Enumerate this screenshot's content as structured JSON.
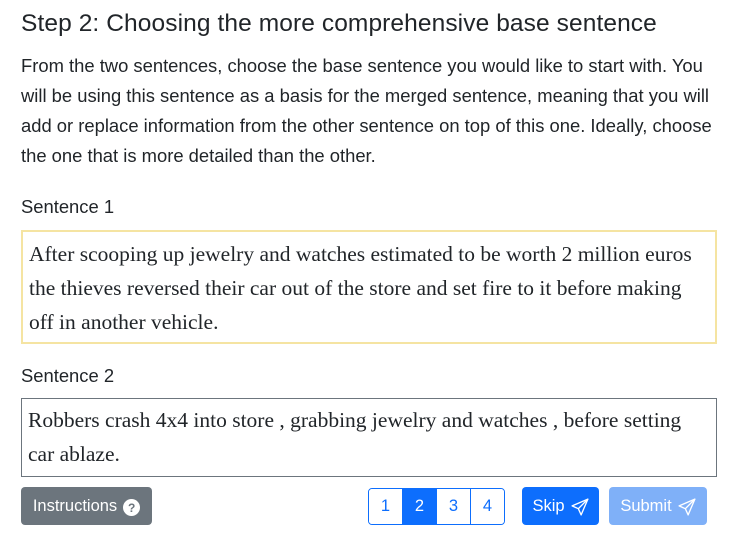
{
  "header": {
    "title": "Step 2: Choosing the more comprehensive base sentence",
    "description": "From the two sentences, choose the base sentence you would like to start with. You will be using this sentence as a basis for the merged sentence, meaning that you will add or replace information from the other sentence on top of this one. Ideally, choose the one that is more detailed than the other."
  },
  "sentences": [
    {
      "label": "Sentence 1",
      "text": "After scooping up jewelry and watches estimated to be worth 2 million euros the thieves reversed their car out of the store and set fire to it before making off in another vehicle.",
      "highlighted": true,
      "border_color": "#f5e4a2"
    },
    {
      "label": "Sentence 2",
      "text": "Robbers crash 4x4 into store , grabbing jewelry and watches , before setting car ablaze.",
      "highlighted": false,
      "border_color": "#6c757d"
    }
  ],
  "footer": {
    "instructions_label": "Instructions",
    "instructions_icon": "question-circle-icon",
    "pages": [
      "1",
      "2",
      "3",
      "4"
    ],
    "active_page": "2",
    "skip_label": "Skip",
    "skip_icon": "send-icon",
    "submit_label": "Submit",
    "submit_icon": "send-icon",
    "submit_enabled": false
  },
  "colors": {
    "primary": "#0d6efd",
    "primary_disabled": "#7fb0f8",
    "secondary": "#6c757d"
  }
}
